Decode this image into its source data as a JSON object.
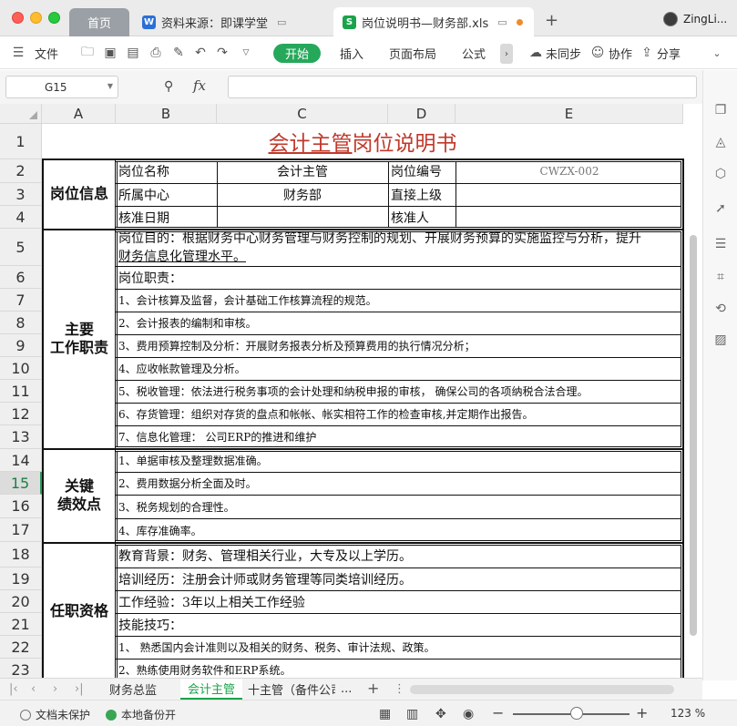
{
  "window": {
    "tabs": [
      {
        "label": "首页"
      },
      {
        "label": "资料来源：即课学堂",
        "badge": "W"
      },
      {
        "label": "岗位说明书—财务部.xls",
        "badge": "S"
      }
    ],
    "new_tab": "+",
    "user_name": "ZingLi..."
  },
  "toolbar": {
    "file": "文件",
    "start": "开始",
    "insert": "插入",
    "page_layout": "页面布局",
    "formula": "公式",
    "more": "›",
    "sync": "未同步",
    "collab": "协作",
    "share": "分享"
  },
  "formula_bar": {
    "cell_ref": "G15",
    "fx_label": "fx",
    "content": ""
  },
  "columns": [
    {
      "label": "A"
    },
    {
      "label": "B"
    },
    {
      "label": "C"
    },
    {
      "label": "D"
    },
    {
      "label": "E"
    }
  ],
  "rows": [
    "1",
    "2",
    "3",
    "4",
    "5",
    "6",
    "7",
    "8",
    "9",
    "10",
    "11",
    "12",
    "13",
    "14",
    "15",
    "16",
    "17",
    "18",
    "19",
    "20",
    "21",
    "22",
    "23"
  ],
  "selected_row": "15",
  "sheet": {
    "title_part1": "会计主管",
    "title_part2": "岗位说明书",
    "section_info": "岗位信息",
    "label_post_name": "岗位名称",
    "post_name": "会计主管",
    "label_post_no": "岗位编号",
    "post_no": "CWZX-002",
    "label_center": "所属中心",
    "center": "财务部",
    "label_superior": "直接上级",
    "superior": "",
    "label_approve_date": "核准日期",
    "approve_date": "",
    "label_approver": "核准人",
    "approver": "",
    "section_duties_1": "主要",
    "section_duties_2": "工作职责",
    "purpose_line1": "岗位目的：根据财务中心财务管理与财务控制的规划、开展财务预算的实施监控与分析，提升",
    "purpose_line2": "财务信息化管理水平。",
    "duties_header": "岗位职责：",
    "duties": [
      "1、会计核算及监督，会计基础工作核算流程的规范。",
      "2、会计报表的编制和审核。",
      "3、费用预算控制及分析：开展财务报表分析及预算费用的执行情况分析；",
      "4、应收帐款管理及分析。",
      "5、税收管理：依法进行税务事项的会计处理和纳税申报的审核， 确保公司的各项纳税合法合理。",
      "6、存货管理：组织对存货的盘点和帐帐、帐实相符工作的检查审核,并定期作出报告。",
      "7、信息化管理： 公司ERP的推进和维护"
    ],
    "section_kpi_1": "关键",
    "section_kpi_2": "绩效点",
    "kpis": [
      "1、单据审核及整理数据准确。",
      "2、费用数据分析全面及时。",
      "3、税务规划的合理性。",
      "4、库存准确率。"
    ],
    "section_qual": "任职资格",
    "qual_edu": "教育背景：财务、管理相关行业，大专及以上学历。",
    "qual_train": "培训经历：注册会计师或财务管理等同类培训经历。",
    "qual_exp": "工作经验：3年以上相关工作经验",
    "qual_skill_header": "技能技巧：",
    "skills": [
      "1、 熟悉国内会计准则以及相关的财务、税务、审计法规、政策。",
      "2、熟练使用财务软件和ERP系统。"
    ]
  },
  "sheet_tabs": [
    {
      "label": "财务总监"
    },
    {
      "label": "会计主管"
    },
    {
      "label": "十主管（备件公司"
    },
    {
      "label": "..."
    }
  ],
  "status": {
    "protect": "文档未保护",
    "backup": "本地备份开",
    "zoom": "123 %",
    "zoom_level_percent": 123
  },
  "colors": {
    "accent_green": "#26a85a",
    "title_red": "#c0392b",
    "backup_dot": "#3aa655"
  }
}
